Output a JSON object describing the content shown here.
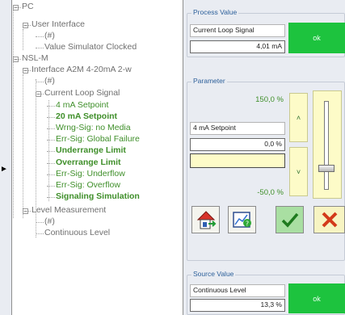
{
  "tree": {
    "nodes": [
      {
        "label": "PC",
        "color": "gray",
        "bold": false
      },
      {
        "label": "User Interface",
        "color": "gray",
        "bold": false
      },
      {
        "label": "(#)",
        "color": "gray",
        "bold": false
      },
      {
        "label": "Value Simulator Clocked",
        "color": "gray",
        "bold": false
      },
      {
        "label": "NSL-M",
        "color": "gray",
        "bold": false
      },
      {
        "label": "Interface A2M 4-20mA 2-w",
        "color": "gray",
        "bold": false
      },
      {
        "label": "(#)",
        "color": "gray",
        "bold": false
      },
      {
        "label": "Current Loop Signal",
        "color": "gray",
        "bold": false
      },
      {
        "label": "4 mA Setpoint",
        "color": "green",
        "bold": false
      },
      {
        "label": "20 mA Setpoint",
        "color": "green",
        "bold": true
      },
      {
        "label": "Wrng-Sig: no Media",
        "color": "green",
        "bold": false
      },
      {
        "label": "Err-Sig: Global Failure",
        "color": "green",
        "bold": false
      },
      {
        "label": "Underrange Limit",
        "color": "green",
        "bold": true
      },
      {
        "label": "Overrange Limit",
        "color": "green",
        "bold": true
      },
      {
        "label": "Err-Sig: Underflow",
        "color": "green",
        "bold": false
      },
      {
        "label": "Err-Sig: Overflow",
        "color": "green",
        "bold": false
      },
      {
        "label": "Signaling Simulation",
        "color": "green",
        "bold": true
      },
      {
        "label": "Level Measurement",
        "color": "gray",
        "bold": false
      },
      {
        "label": "(#)",
        "color": "gray",
        "bold": false
      },
      {
        "label": "Continuous Level",
        "color": "gray",
        "bold": false
      }
    ]
  },
  "process_value": {
    "group_label": "Process Value",
    "name": "Current Loop Signal",
    "value": "4,01 mA",
    "status": "ok"
  },
  "parameter": {
    "group_label": "Parameter",
    "max": "150,0 %",
    "name": "4 mA Setpoint",
    "value": "0,0 %",
    "input": "",
    "min": "-50,0 %",
    "up_symbol": "˄",
    "down_symbol": "˅",
    "slider_level": 0.25
  },
  "source_value": {
    "group_label": "Source Value",
    "name": "Continuous Level",
    "value": "13,3 %",
    "status": "ok"
  },
  "colors": {
    "ok_green": "#1dc33e",
    "tree_green": "#3f8f2a",
    "group_label_blue": "#2c5f9a",
    "step_yellow": "#fdfbc8"
  },
  "icons": [
    "arrow-right-icon",
    "home-exit-icon",
    "chart-help-icon",
    "checkmark-icon",
    "cancel-x-icon"
  ]
}
